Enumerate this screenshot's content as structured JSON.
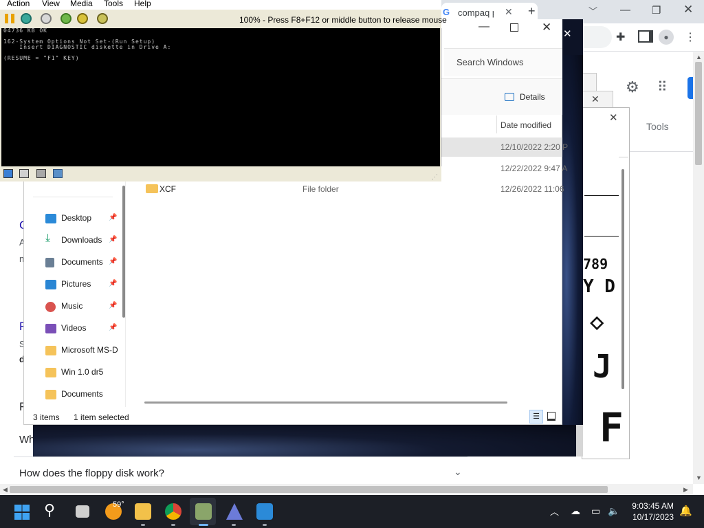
{
  "chrome": {
    "tab_title": "compaq p",
    "tab_favicon": "G",
    "new_tab_symbol": "+",
    "tools_label": "Tools",
    "faq_question": "How does the floppy disk work?",
    "partial_text": [
      "C",
      "A",
      "n",
      "F",
      "S",
      "d",
      "F",
      "Wh"
    ]
  },
  "vpc": {
    "menu": [
      "Action",
      "View",
      "Media",
      "Tools",
      "Help"
    ],
    "status": "100% - Press F8+F12 or middle button to release mouse",
    "screen_lines": [
      "04736 KB OK",
      "162-System Options Not Set-(Run Setup)",
      "    Insert DIAGNOSTIC diskette in Drive A:",
      "(RESUME = \"F1\" KEY)"
    ]
  },
  "explorer": {
    "search_placeholder": "Search Windows",
    "details_label": "Details",
    "column_date": "Date modified",
    "rows": [
      {
        "name": "",
        "type": "",
        "date": "12/10/2022 2:20 P"
      },
      {
        "name": "",
        "type": "",
        "date": "12/22/2022 9:47 A"
      },
      {
        "name": "XCF",
        "type": "File folder",
        "date": "12/26/2022 11:06"
      }
    ],
    "nav": [
      {
        "label": "Desktop",
        "icon": "desktop-icon",
        "color": "#2b8ad8",
        "pinned": true
      },
      {
        "label": "Downloads",
        "icon": "download-icon",
        "color": "#1f9e6e",
        "pinned": true
      },
      {
        "label": "Documents",
        "icon": "documents-icon",
        "color": "#6a7f95",
        "pinned": true
      },
      {
        "label": "Pictures",
        "icon": "pictures-icon",
        "color": "#2a86d4",
        "pinned": true
      },
      {
        "label": "Music",
        "icon": "music-icon",
        "color": "#d9534f",
        "pinned": true
      },
      {
        "label": "Videos",
        "icon": "videos-icon",
        "color": "#7a4fb7",
        "pinned": true
      },
      {
        "label": "Microsoft MS-D",
        "icon": "folder-icon",
        "color": "#f5c35a",
        "pinned": false
      },
      {
        "label": "Win 1.0 dr5",
        "icon": "folder-icon",
        "color": "#f5c35a",
        "pinned": false
      },
      {
        "label": "Documents",
        "icon": "folder-icon",
        "color": "#f5c35a",
        "pinned": false
      }
    ],
    "item_count": "3 items",
    "selected_count": "1 item selected"
  },
  "fontviewer": {
    "samples": [
      "789",
      "Y D",
      "◇",
      "J",
      "F"
    ]
  },
  "taskbar": {
    "temperature": "59°",
    "time": "9:03:45 AM",
    "date": "10/17/2023"
  }
}
